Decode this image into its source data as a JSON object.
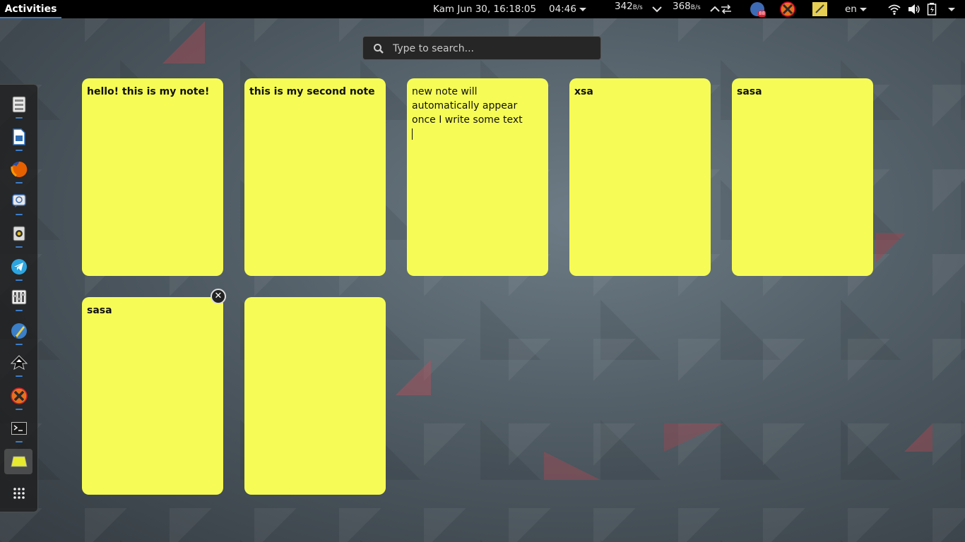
{
  "topbar": {
    "activities": "Activities",
    "clock": "Kam Jun 30, 16:18:05",
    "timer": "04:46",
    "net_down_value": "342",
    "net_down_unit": "B/s",
    "net_up_value": "368",
    "net_up_unit": "B/s",
    "keyboard_layout": "en",
    "badge_count": "88"
  },
  "search": {
    "placeholder": "Type to search..."
  },
  "dash": {
    "items": [
      {
        "icon": "file-manager-icon",
        "running": true
      },
      {
        "icon": "document-viewer-icon",
        "running": true
      },
      {
        "icon": "firefox-icon",
        "running": true
      },
      {
        "icon": "chat-icon",
        "running": true
      },
      {
        "icon": "music-player-icon",
        "running": true
      },
      {
        "icon": "telegram-icon",
        "running": true
      },
      {
        "icon": "system-monitor-icon",
        "running": true
      },
      {
        "icon": "writer-icon",
        "running": true
      },
      {
        "icon": "inkscape-icon",
        "running": true
      },
      {
        "icon": "crossover-icon",
        "running": true
      },
      {
        "icon": "terminal-icon",
        "running": true
      },
      {
        "icon": "sticky-notes-icon",
        "running": false,
        "active": true
      },
      {
        "icon": "app-grid-icon",
        "running": false
      }
    ]
  },
  "notes": [
    {
      "text": "hello! this is my note!"
    },
    {
      "text": "this is my second note"
    },
    {
      "text": "new note will automatically appear once I write some text"
    },
    {
      "text": "xsa"
    },
    {
      "text": "sasa"
    },
    {
      "text": "sasa"
    },
    {
      "text": ""
    }
  ],
  "colors": {
    "note_bg": "#f6fc55",
    "accent": "#3d7cc9",
    "topbar_bg": "#000000"
  }
}
